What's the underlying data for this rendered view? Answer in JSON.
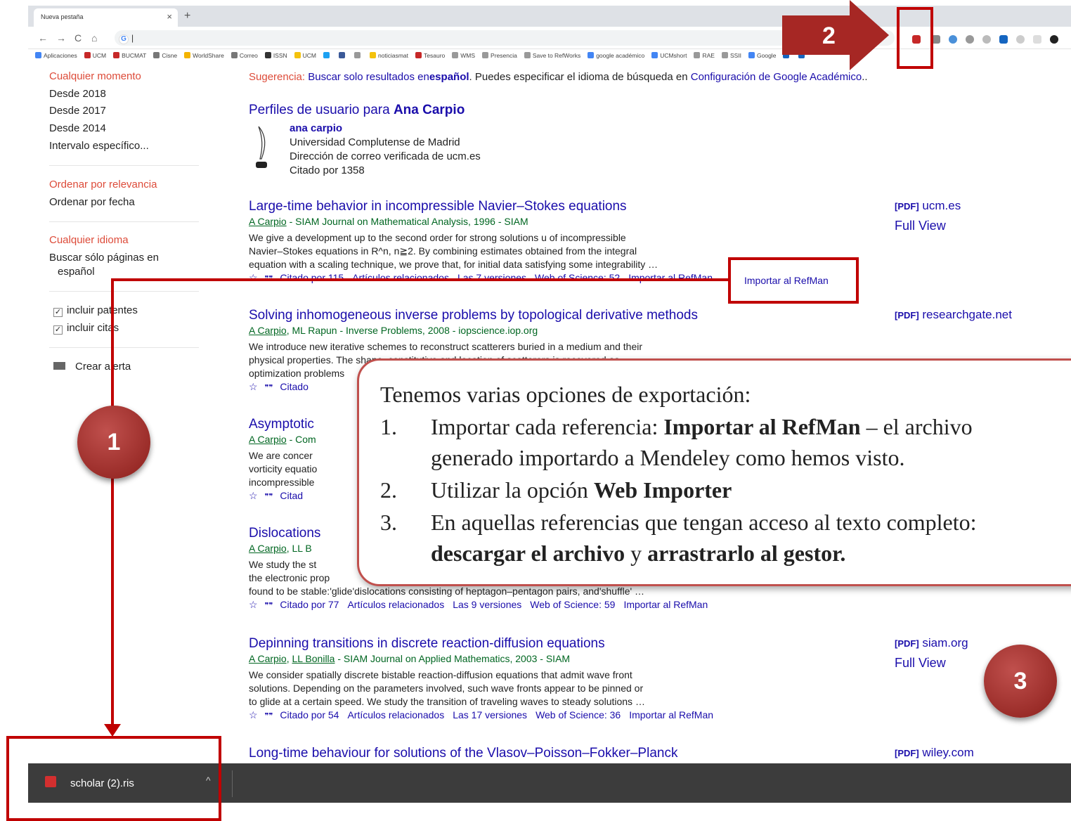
{
  "browser": {
    "tab_title": "Nueva pestaña",
    "tab_close": "×",
    "new_tab": "+",
    "nav": {
      "back": "←",
      "forward": "→",
      "reload": "C",
      "home": "⌂"
    },
    "omnibox_value": "G",
    "bookmarks": [
      "Aplicaciones",
      "UCM",
      "BUCMAT",
      "Cisne",
      "WorldShare",
      "Correo",
      "ISSN",
      "UCM",
      "",
      "",
      "",
      "noticiasmat",
      "Tesauro",
      "WMS",
      "Presencia",
      "Save to RefWorks",
      "google académico",
      "UCMshort",
      "RAE",
      "SSII",
      "Google",
      "",
      ""
    ]
  },
  "sidebar": {
    "time": [
      "Cualquier momento",
      "Desde 2018",
      "Desde 2017",
      "Desde 2014",
      "Intervalo específico..."
    ],
    "sort": [
      "Ordenar por relevancia",
      "Ordenar por fecha"
    ],
    "lang": [
      "Cualquier idioma",
      "Buscar sólo páginas en",
      "español"
    ],
    "checks": [
      "incluir patentes",
      "incluir citas"
    ],
    "alert": "Crear alerta"
  },
  "suggestion": {
    "prefix": "Sugerencia:",
    "l1": "Buscar solo resultados en",
    "l1b": "español",
    "mid": ". Puedes especificar el idioma de búsqueda en",
    "l2": "Configuración de Google Académico",
    "end": ".."
  },
  "profiles": {
    "heading": "Perfiles de usuario para",
    "heading_name": "Ana Carpio",
    "name": "ana carpio",
    "affil": "Universidad Complutense de Madrid",
    "email": "Dirección de correo verificada de ucm.es",
    "cited": "Citado por 1358"
  },
  "results": [
    {
      "title": "Large-time behavior in incompressible Navier–Stokes equations",
      "authors": "A Carpio",
      "source": " - SIAM Journal on Mathematical Analysis, 1996 - SIAM",
      "snippet": [
        "We give a development up to the second order for strong solutions u of incompressible",
        "Navier–Stokes equations in R^n, n≧2. By combining estimates obtained from the integral",
        "equation with a scaling technique, we prove that, for initial data satisfying some integrability …"
      ],
      "links": [
        "Citado por 115",
        "Artículos relacionados",
        "Las 7 versiones",
        "Web of Science: 52",
        "Importar al RefMan"
      ],
      "right1": "[PDF]",
      "right1b": " ucm.es",
      "right2": "Full View"
    },
    {
      "title": "Solving inhomogeneous inverse problems by topological derivative methods",
      "authors": "A Carpio",
      "source": ", ML Rapun - Inverse Problems, 2008 - iopscience.iop.org",
      "snippet": [
        "We introduce new iterative schemes to reconstruct scatterers buried in a medium and their",
        "physical properties. The shape, constitutive and location of scatterers is recovered as",
        "optimization problems"
      ],
      "links": [
        "Citado"
      ],
      "right1": "[PDF]",
      "right1b": " researchgate.net",
      "right2": ""
    },
    {
      "title": "Asymptotic",
      "authors": "A Carpio",
      "source": " - Com",
      "snippet": [
        "We are concer",
        "vorticity equatio",
        "incompressible"
      ],
      "links": [
        "Citad"
      ],
      "right1": "",
      "right1b": "",
      "right2": ""
    },
    {
      "title": "Dislocations",
      "authors": "A Carpio",
      "source": ", LL B",
      "snippet": [
        "We study the st",
        "the electronic prop",
        "found to be stable:'glide'dislocations consisting of heptagon–pentagon pairs, and'shuffle' …"
      ],
      "links": [
        "Citado por 77",
        "Artículos relacionados",
        "Las 9 versiones",
        "Web of Science: 59",
        "Importar al RefMan"
      ],
      "right1": "",
      "right1b": "",
      "right2": ""
    },
    {
      "title": "Depinning transitions in discrete reaction-diffusion equations",
      "authors": "A Carpio",
      "source_author2": "LL Bonilla",
      "source": " - SIAM Journal on Applied Mathematics, 2003 - SIAM",
      "snippet": [
        "We consider spatially discrete bistable reaction-diffusion equations that admit wave front",
        "solutions. Depending on the parameters involved, such wave fronts appear to be pinned or",
        "to glide at a certain speed. We study the transition of traveling waves to steady solutions …"
      ],
      "links": [
        "Citado por 54",
        "Artículos relacionados",
        "Las 17 versiones",
        "Web of Science: 36",
        "Importar al RefMan"
      ],
      "right1": "[PDF]",
      "right1b": " siam.org",
      "right2": "Full View"
    },
    {
      "title": "Long-time behaviour for solutions of the Vlasov–Poisson–Fokker–Planck",
      "right1": "[PDF]",
      "right1b": " wiley.com"
    }
  ],
  "download": {
    "filename": "scholar (2).ris",
    "chevron": "^"
  },
  "annotations": {
    "badge1": "1",
    "badge2": "2",
    "badge3": "3",
    "callout_heading": "Tenemos varias opciones de exportación:",
    "item1_num": "1.",
    "item1_pre": "Importar cada referencia: ",
    "item1_bold": "Importar al RefMan",
    "item1_post": " – el archivo",
    "item1_line2": "generado importardo a Mendeley como hemos visto.",
    "item2_num": "2.",
    "item2_pre": "Utilizar la opción ",
    "item2_bold": "Web Importer",
    "item3_num": "3.",
    "item3_line1": "En aquellas referencias que tengan acceso al texto completo:",
    "item3_bold1": "descargar el archivo",
    "item3_mid": " y ",
    "item3_bold2": "arrastrarlo al gestor."
  },
  "colors": {
    "accent_red": "#c00000",
    "link": "#1a0dab",
    "green": "#006621",
    "side_red": "#dd4b39"
  }
}
